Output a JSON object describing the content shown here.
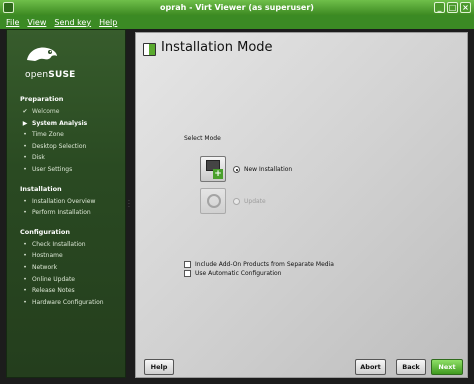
{
  "window": {
    "title": "oprah - Virt Viewer (as superuser)"
  },
  "menu": [
    "File",
    "View",
    "Send key",
    "Help"
  ],
  "sidebar": {
    "logo_text": {
      "prefix": "open",
      "suffix": "SUSE"
    },
    "groups": [
      {
        "heading": "Preparation",
        "items": [
          {
            "label": "Welcome",
            "state": "done"
          },
          {
            "label": "System Analysis",
            "state": "active"
          },
          {
            "label": "Time Zone",
            "state": "pending"
          },
          {
            "label": "Desktop Selection",
            "state": "pending"
          },
          {
            "label": "Disk",
            "state": "pending"
          },
          {
            "label": "User Settings",
            "state": "pending"
          }
        ]
      },
      {
        "heading": "Installation",
        "items": [
          {
            "label": "Installation Overview",
            "state": "pending"
          },
          {
            "label": "Perform Installation",
            "state": "pending"
          }
        ]
      },
      {
        "heading": "Configuration",
        "items": [
          {
            "label": "Check Installation",
            "state": "pending"
          },
          {
            "label": "Hostname",
            "state": "pending"
          },
          {
            "label": "Network",
            "state": "pending"
          },
          {
            "label": "Online Update",
            "state": "pending"
          },
          {
            "label": "Release Notes",
            "state": "pending"
          },
          {
            "label": "Hardware Configuration",
            "state": "pending"
          }
        ]
      }
    ]
  },
  "main": {
    "title": "Installation Mode",
    "select_label": "Select Mode",
    "options": [
      {
        "label": "New Installation",
        "selected": true,
        "enabled": true,
        "icon": "new-installation-icon"
      },
      {
        "label": "Update",
        "selected": false,
        "enabled": false,
        "icon": "update-icon"
      }
    ],
    "checkboxes": [
      {
        "label": "Include Add-On Products from Separate Media",
        "checked": false
      },
      {
        "label": "Use Automatic Configuration",
        "checked": false
      }
    ]
  },
  "buttons": {
    "help": "Help",
    "abort": "Abort",
    "back": "Back",
    "next": "Next"
  },
  "colors": {
    "accent": "#5aaa2e",
    "sidebar": "#2a4a22",
    "titlebar": "#4d9a2e"
  }
}
